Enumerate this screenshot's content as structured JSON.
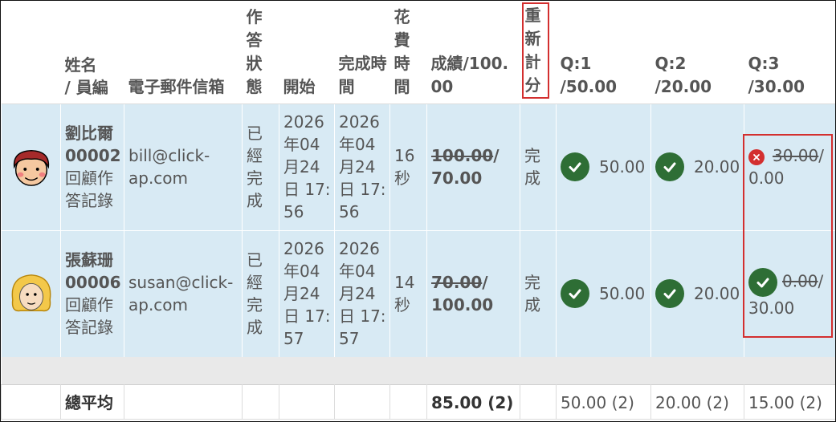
{
  "header": {
    "name": "姓名",
    "emp_no": "/ 員編",
    "email": "電子郵件信箱",
    "status": "作答狀態",
    "start": "開始",
    "finish": "完成時間",
    "duration": "花費時間",
    "score": "成績/100.00",
    "regrade": "重新計分",
    "q1": "Q:1 /50.00",
    "q2": "Q:2 /20.00",
    "q3": "Q:3 /30.00"
  },
  "rows": [
    {
      "name": "劉比爾",
      "emp_no": "00002",
      "review": "回顧作答記錄",
      "email": "bill@click-ap.com",
      "status": "已經完成",
      "start": "2026年04月24日 17:56",
      "finish": "2026年04月24日 17:56",
      "duration": "16 秒",
      "score_old": "100.00",
      "score_new": "/ 70.00",
      "regrade": "完成",
      "q1": "50.00",
      "q2": "20.00",
      "q3_old": "30.00",
      "q3_new": "/ 0.00"
    },
    {
      "name": "張蘇珊",
      "emp_no": "00006",
      "review": "回顧作答記錄",
      "email": "susan@click-ap.com",
      "status": "已經完成",
      "start": "2026年04月24日 17:57",
      "finish": "2026年04月24日 17:57",
      "duration": "14 秒",
      "score_old": "70.00",
      "score_new": "/ 100.00",
      "regrade": "完成",
      "q1": "50.00",
      "q2": "20.00",
      "q3_old": "0.00",
      "q3_new": "/ 30.00"
    }
  ],
  "footer": {
    "label": "總平均",
    "score": "85.00 (2)",
    "q1": "50.00 (2)",
    "q2": "20.00 (2)",
    "q3": "15.00 (2)"
  },
  "colors": {
    "row_bg": "#d8eaf4",
    "check": "#2e6e35",
    "cross": "#d32f2f",
    "highlight": "#d32f2f"
  },
  "icons": {
    "correct": "check-circle-icon",
    "wrong": "x-circle-icon"
  }
}
